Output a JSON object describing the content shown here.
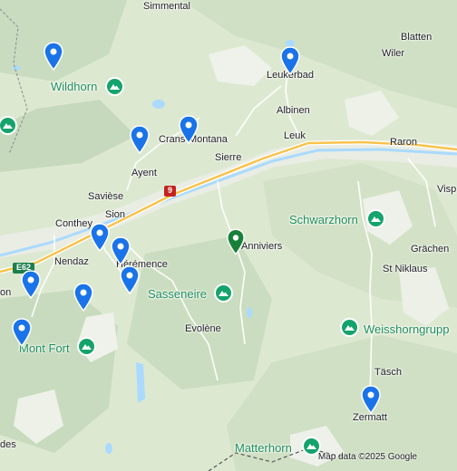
{
  "map": {
    "attribution": "Map data ©2025 Google",
    "places": {
      "simmental": "Simmental",
      "blatten": "Blatten",
      "wiler": "Wiler",
      "leukerbad": "Leukerbad",
      "albinen": "Albinen",
      "leuk": "Leuk",
      "raron": "Raron",
      "crans_montana": "Crans-Montana",
      "sierre": "Sierre",
      "ayent": "Ayent",
      "saviese": "Savièse",
      "sion": "Sion",
      "conthey": "Conthey",
      "nendaz": "Nendaz",
      "heremence": "Hérémence",
      "anniviers": "Anniviers",
      "evolene": "Evolène",
      "grachen": "Grächen",
      "st_niklaus": "St Niklaus",
      "tasch": "Täsch",
      "zermatt": "Zermatt",
      "visp_partial": "Visp",
      "des_partial": "des",
      "on_partial": "on"
    },
    "peaks": {
      "wildhorn": "Wildhorn",
      "schwarzhorn": "Schwarzhorn",
      "sasseneire": "Sasseneire",
      "mont_fort": "Mont Fort",
      "weisshorngruppe": "Weisshorngrupp",
      "matterhorn": "Matterhorn"
    },
    "roads": {
      "route_9": "9",
      "e62": "E62"
    },
    "icons": {
      "pin": "map-pin-icon",
      "peak": "mountain-icon"
    },
    "colors": {
      "pin_blue": "#1a73e8",
      "pin_green": "#188038",
      "peak_green": "#15a36c",
      "water": "#aadaff",
      "road": "#ffffff",
      "highway": "#f9c24a"
    }
  }
}
